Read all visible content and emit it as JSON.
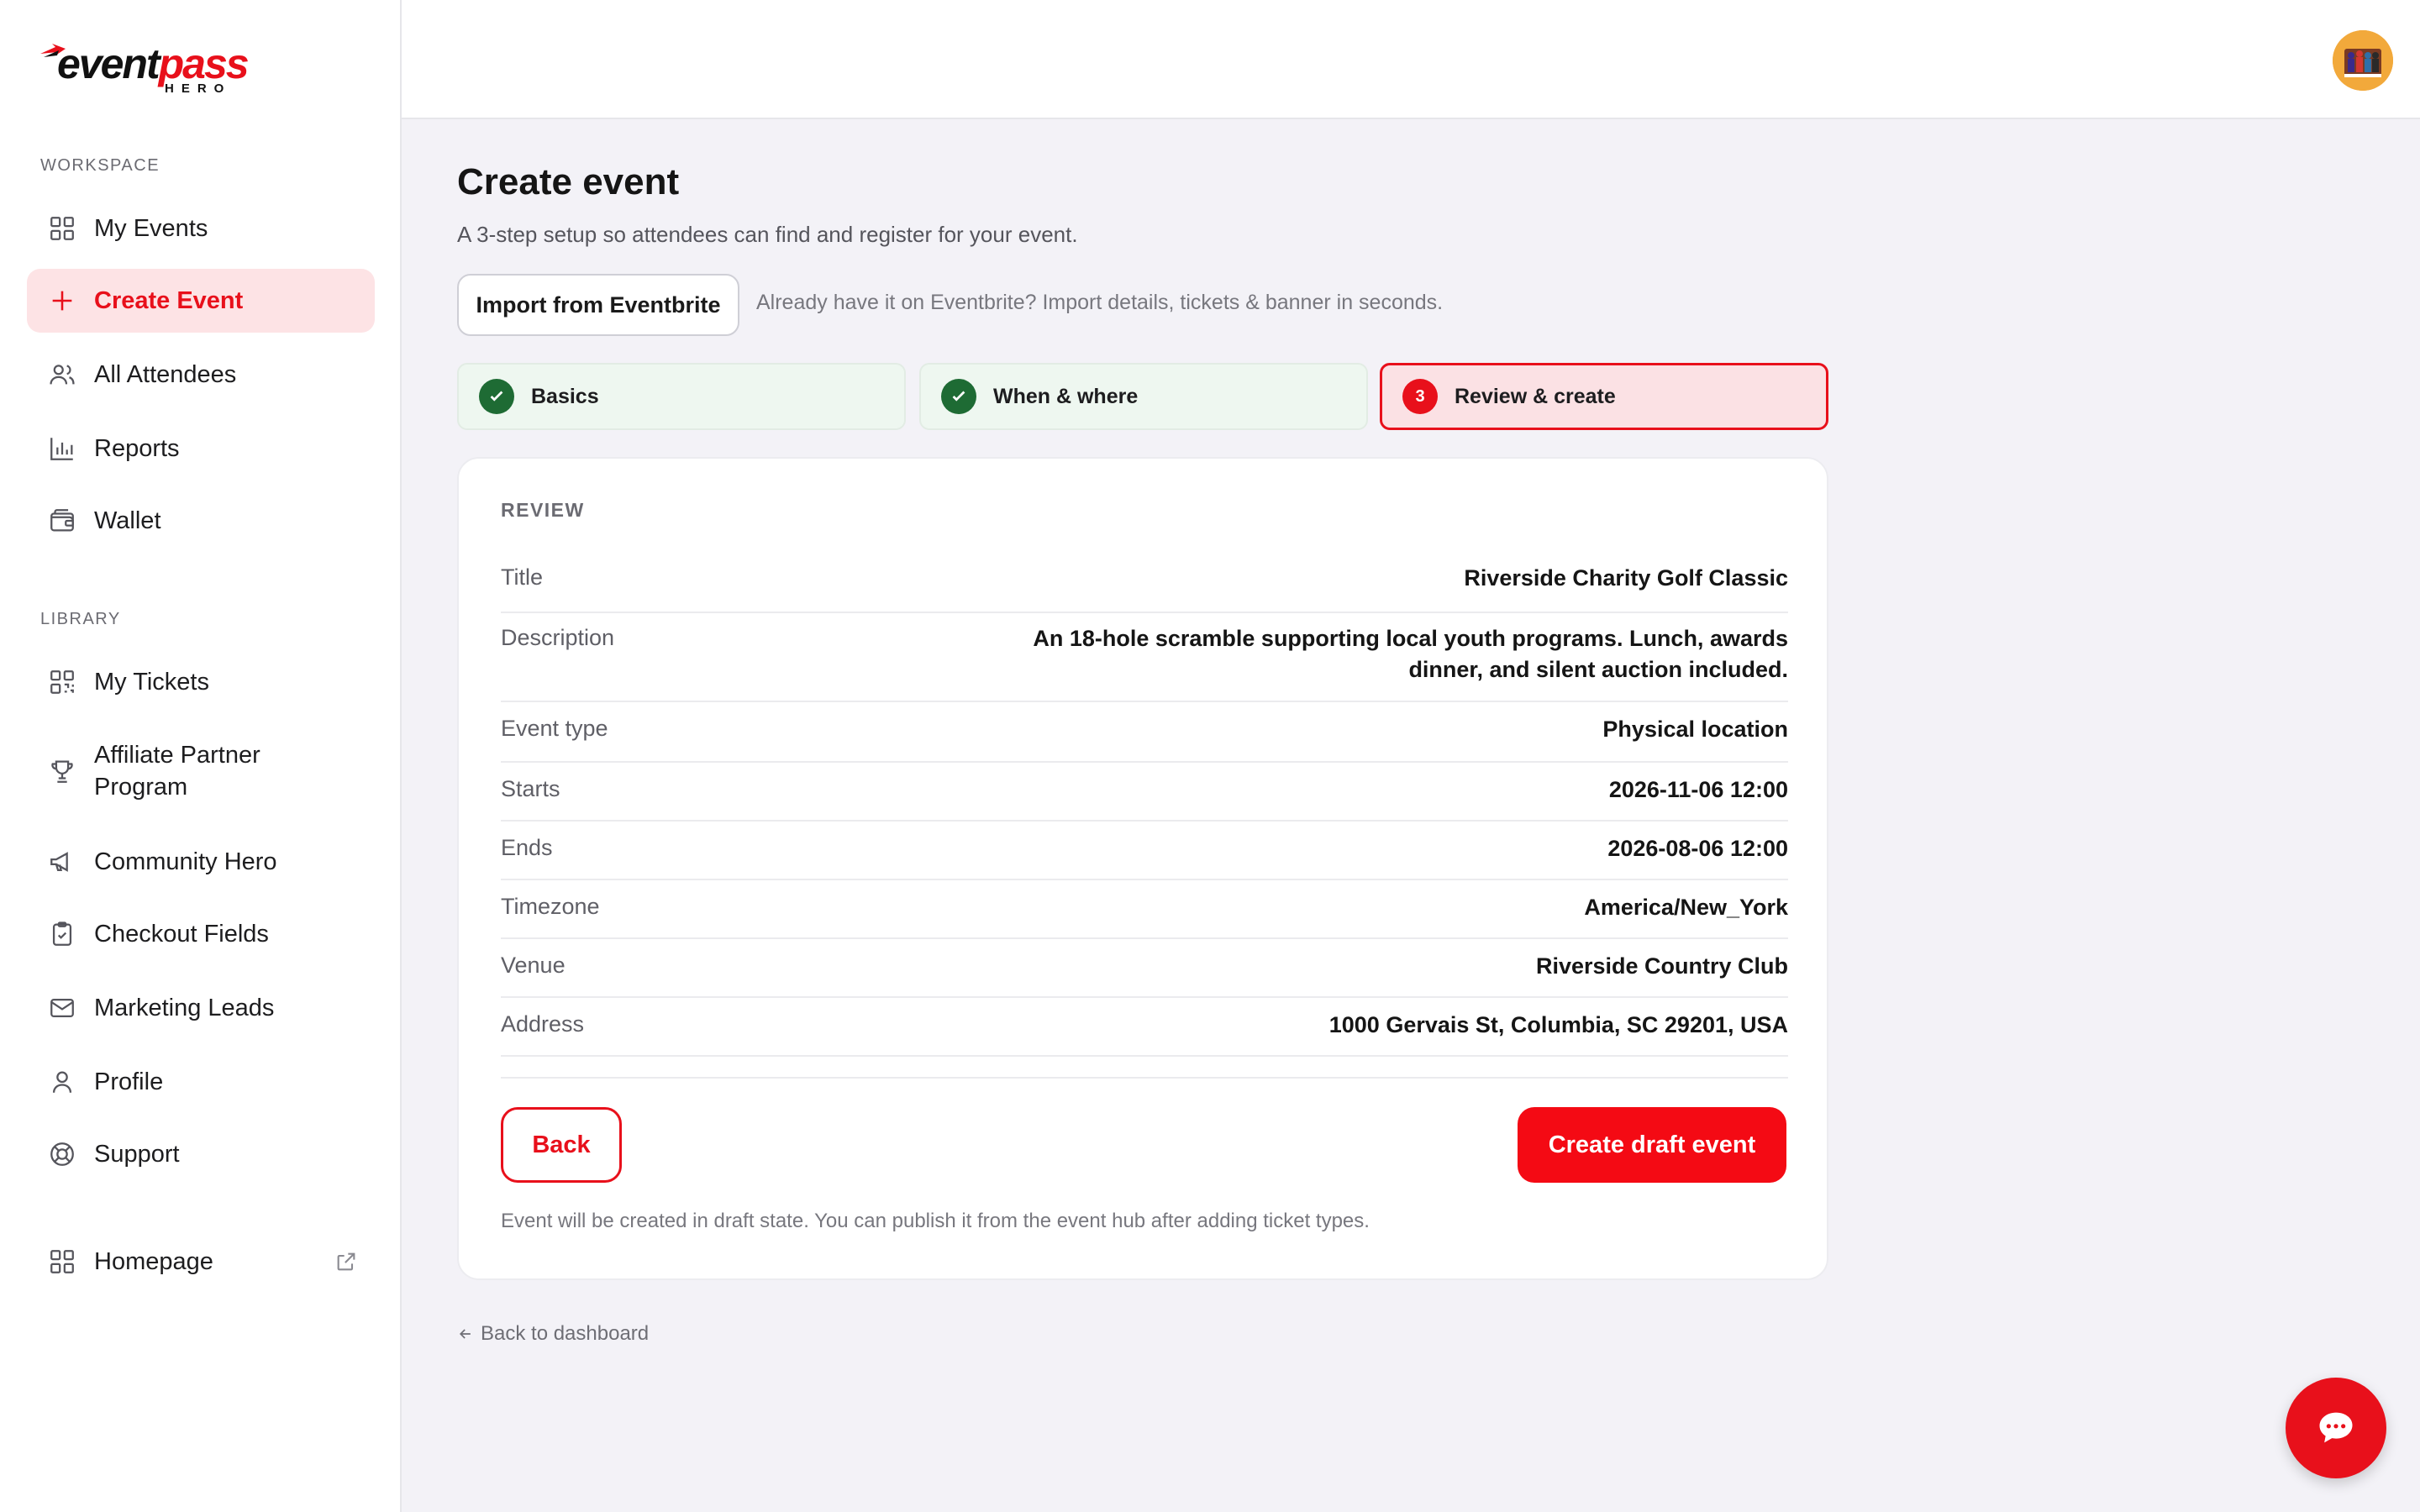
{
  "brand": {
    "logo_text_a": "event",
    "logo_text_b": "pass",
    "logo_sub": "HERO"
  },
  "sidebar": {
    "workspace_label": "WORKSPACE",
    "library_label": "LIBRARY",
    "workspace_items": [
      {
        "label": "My Events",
        "icon": "grid-icon"
      },
      {
        "label": "Create Event",
        "icon": "plus-icon",
        "active": true
      },
      {
        "label": "All Attendees",
        "icon": "users-icon"
      },
      {
        "label": "Reports",
        "icon": "bar-chart-icon"
      },
      {
        "label": "Wallet",
        "icon": "wallet-icon"
      }
    ],
    "library_items": [
      {
        "label": "My Tickets",
        "icon": "qr-code-icon"
      },
      {
        "label": "Affiliate Partner Program",
        "icon": "trophy-icon"
      },
      {
        "label": "Community Hero",
        "icon": "megaphone-icon"
      },
      {
        "label": "Checkout Fields",
        "icon": "clipboard-check-icon"
      },
      {
        "label": "Marketing Leads",
        "icon": "mail-icon"
      },
      {
        "label": "Profile",
        "icon": "user-icon"
      },
      {
        "label": "Support",
        "icon": "lifebuoy-icon"
      }
    ],
    "homepage": {
      "label": "Homepage",
      "icon": "grid-icon",
      "trailing_icon": "external-link-icon"
    }
  },
  "header": {
    "avatar": "avatar"
  },
  "main": {
    "title": "Create event",
    "subtitle": "A 3-step setup so attendees can find and register for your event.",
    "import_button": "Import from Eventbrite",
    "import_hint": "Already have it on Eventbrite? Import details, tickets & banner in seconds.",
    "steps": [
      {
        "label": "Basics",
        "state": "done"
      },
      {
        "label": "When & where",
        "state": "done"
      },
      {
        "number": "3",
        "label": "Review & create",
        "state": "current"
      }
    ],
    "review": {
      "section_label": "REVIEW",
      "rows": [
        {
          "key": "Title",
          "value": "Riverside Charity Golf Classic"
        },
        {
          "key": "Description",
          "value_line1": "An 18-hole scramble supporting local youth programs. Lunch, awards",
          "value_line2": "dinner, and silent auction included."
        },
        {
          "key": "Event type",
          "value": "Physical location"
        },
        {
          "key": "Starts",
          "value": "2026-11-06 12:00"
        },
        {
          "key": "Ends",
          "value": "2026-08-06 12:00"
        },
        {
          "key": "Timezone",
          "value": "America/New_York"
        },
        {
          "key": "Venue",
          "value": "Riverside Country Club"
        },
        {
          "key": "Address",
          "value": "1000 Gervais St, Columbia, SC 29201, USA"
        }
      ],
      "back_button": "Back",
      "create_button": "Create draft event",
      "note": "Event will be created in draft state. You can publish it from the event hub after adding ticket types."
    },
    "back_to_dashboard": "Back to dashboard"
  },
  "colors": {
    "accent": "#e8101b",
    "success": "#1e6b34",
    "active_bg": "#fde3e5"
  }
}
